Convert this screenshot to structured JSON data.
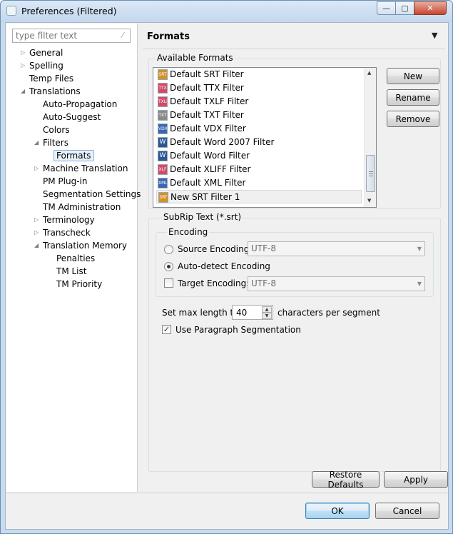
{
  "window": {
    "title": "Preferences (Filtered)",
    "controls": {
      "minimize": "—",
      "maximize": "▢",
      "close": "✕"
    }
  },
  "filter": {
    "placeholder": "type filter text",
    "clear_icon": "⁄"
  },
  "tree": [
    {
      "label": "General",
      "expand": "▷"
    },
    {
      "label": "Spelling",
      "expand": "▷"
    },
    {
      "label": "Temp Files",
      "expand": ""
    },
    {
      "label": "Translations",
      "expand": "◢"
    },
    {
      "label": "Auto-Propagation",
      "expand": ""
    },
    {
      "label": "Auto-Suggest",
      "expand": ""
    },
    {
      "label": "Colors",
      "expand": ""
    },
    {
      "label": "Filters",
      "expand": "◢"
    },
    {
      "label": "Formats",
      "expand": ""
    },
    {
      "label": "Machine Translation",
      "expand": "▷"
    },
    {
      "label": "PM Plug-in",
      "expand": ""
    },
    {
      "label": "Segmentation Settings",
      "expand": ""
    },
    {
      "label": "TM Administration",
      "expand": ""
    },
    {
      "label": "Terminology",
      "expand": "▷"
    },
    {
      "label": "Transcheck",
      "expand": "▷"
    },
    {
      "label": "Translation Memory",
      "expand": "◢"
    },
    {
      "label": "Penalties",
      "expand": ""
    },
    {
      "label": "TM List",
      "expand": ""
    },
    {
      "label": "TM Priority",
      "expand": ""
    }
  ],
  "page": {
    "title": "Formats",
    "menu_icon": "▼"
  },
  "formats": {
    "label": "Available Formats",
    "items": [
      {
        "label": "Default SRT Filter",
        "icon": "SRT",
        "color": "#d2902e"
      },
      {
        "label": "Default TTX Filter",
        "icon": "TTX",
        "color": "#d44a6a"
      },
      {
        "label": "Default TXLF Filter",
        "icon": "TXLF",
        "color": "#d44a6a"
      },
      {
        "label": "Default TXT Filter",
        "icon": "TXT",
        "color": "#8a8a8a"
      },
      {
        "label": "Default VDX Filter",
        "icon": "VDX",
        "color": "#3a66b5"
      },
      {
        "label": "Default Word 2007 Filter",
        "icon": "W",
        "color": "#2b5797"
      },
      {
        "label": "Default Word Filter",
        "icon": "W",
        "color": "#2b5797"
      },
      {
        "label": "Default XLIFF Filter",
        "icon": "XLF",
        "color": "#d44a6a"
      },
      {
        "label": "Default XML Filter",
        "icon": "XML",
        "color": "#3a66b5"
      },
      {
        "label": "New SRT Filter 1",
        "icon": "SRT",
        "color": "#d2902e"
      }
    ],
    "scroll_up": "▲",
    "scroll_down": "▼",
    "new_button": "New",
    "rename_button": "Rename",
    "remove_button": "Remove"
  },
  "subrip": {
    "label": "SubRip Text (*.srt)",
    "encoding_label": "Encoding",
    "source_encoding_label": "Source Encoding:",
    "source_encoding_value": "UTF-8",
    "auto_detect_label": "Auto-detect Encoding",
    "target_encoding_label": "Target Encoding:",
    "target_encoding_value": "UTF-8",
    "dropdown_icon": "▼",
    "max_length_label": "Set max length to",
    "max_length_value": "40",
    "max_length_suffix": "characters per segment",
    "spin_up": "▲",
    "spin_down": "▼",
    "paragraph_label": "Use Paragraph Segmentation",
    "paragraph_checked": "✓"
  },
  "footer": {
    "restore_defaults": "Restore Defaults",
    "apply": "Apply",
    "ok": "OK",
    "cancel": "Cancel"
  }
}
